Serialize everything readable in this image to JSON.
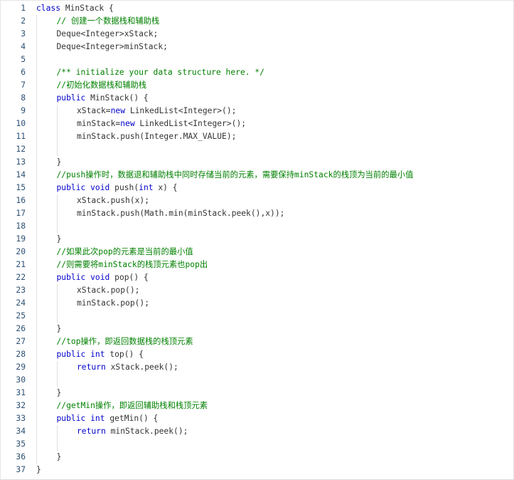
{
  "editor": {
    "colors": {
      "keyword": "#0000cc",
      "comment": "#008000",
      "text": "#333333",
      "line_number": "#2b4f73"
    },
    "lines": [
      {
        "n": "1",
        "indent": 0,
        "tokens": [
          {
            "t": "kw",
            "v": "class"
          },
          {
            "t": "tx",
            "v": " MinStack {"
          }
        ]
      },
      {
        "n": "2",
        "indent": 1,
        "tokens": [
          {
            "t": "cm",
            "v": "// 创建一个数据栈和辅助栈"
          }
        ]
      },
      {
        "n": "3",
        "indent": 1,
        "tokens": [
          {
            "t": "tx",
            "v": "Deque<Integer>xStack;"
          }
        ]
      },
      {
        "n": "4",
        "indent": 1,
        "tokens": [
          {
            "t": "tx",
            "v": "Deque<Integer>minStack;"
          }
        ]
      },
      {
        "n": "5",
        "indent": 1,
        "tokens": []
      },
      {
        "n": "6",
        "indent": 1,
        "tokens": [
          {
            "t": "cm",
            "v": "/** initialize your data structure here. */"
          }
        ]
      },
      {
        "n": "7",
        "indent": 1,
        "tokens": [
          {
            "t": "cm",
            "v": "//初始化数据栈和辅助栈"
          }
        ]
      },
      {
        "n": "8",
        "indent": 1,
        "tokens": [
          {
            "t": "kw",
            "v": "public"
          },
          {
            "t": "tx",
            "v": " MinStack() {"
          }
        ]
      },
      {
        "n": "9",
        "indent": 2,
        "tokens": [
          {
            "t": "tx",
            "v": "xStack="
          },
          {
            "t": "kw",
            "v": "new"
          },
          {
            "t": "tx",
            "v": " LinkedList<Integer>();"
          }
        ]
      },
      {
        "n": "10",
        "indent": 2,
        "tokens": [
          {
            "t": "tx",
            "v": "minStack="
          },
          {
            "t": "kw",
            "v": "new"
          },
          {
            "t": "tx",
            "v": " LinkedList<Integer>();"
          }
        ]
      },
      {
        "n": "11",
        "indent": 2,
        "tokens": [
          {
            "t": "tx",
            "v": "minStack.push(Integer.MAX_VALUE);"
          }
        ]
      },
      {
        "n": "12",
        "indent": 2,
        "tokens": []
      },
      {
        "n": "13",
        "indent": 1,
        "tokens": [
          {
            "t": "tx",
            "v": "}"
          }
        ]
      },
      {
        "n": "14",
        "indent": 1,
        "tokens": [
          {
            "t": "cm",
            "v": "//push操作时，数据退和辅助栈中同时存储当前的元素，需要保持minStack的栈顶为当前的最小值"
          }
        ]
      },
      {
        "n": "15",
        "indent": 1,
        "tokens": [
          {
            "t": "kw",
            "v": "public"
          },
          {
            "t": "tx",
            "v": " "
          },
          {
            "t": "kw",
            "v": "void"
          },
          {
            "t": "tx",
            "v": " push("
          },
          {
            "t": "kw",
            "v": "int"
          },
          {
            "t": "tx",
            "v": " x) {"
          }
        ]
      },
      {
        "n": "16",
        "indent": 2,
        "tokens": [
          {
            "t": "tx",
            "v": "xStack.push(x);"
          }
        ]
      },
      {
        "n": "17",
        "indent": 2,
        "tokens": [
          {
            "t": "tx",
            "v": "minStack.push(Math.min(minStack.peek(),x));"
          }
        ]
      },
      {
        "n": "18",
        "indent": 2,
        "tokens": []
      },
      {
        "n": "19",
        "indent": 1,
        "tokens": [
          {
            "t": "tx",
            "v": "}"
          }
        ]
      },
      {
        "n": "20",
        "indent": 1,
        "tokens": [
          {
            "t": "cm",
            "v": "//如果此次pop的元素是当前的最小值"
          }
        ]
      },
      {
        "n": "21",
        "indent": 1,
        "tokens": [
          {
            "t": "cm",
            "v": "//则需要将minStack的栈顶元素也pop出"
          }
        ]
      },
      {
        "n": "22",
        "indent": 1,
        "tokens": [
          {
            "t": "kw",
            "v": "public"
          },
          {
            "t": "tx",
            "v": " "
          },
          {
            "t": "kw",
            "v": "void"
          },
          {
            "t": "tx",
            "v": " pop() {"
          }
        ]
      },
      {
        "n": "23",
        "indent": 2,
        "tokens": [
          {
            "t": "tx",
            "v": "xStack.pop();"
          }
        ]
      },
      {
        "n": "24",
        "indent": 2,
        "tokens": [
          {
            "t": "tx",
            "v": "minStack.pop();"
          }
        ]
      },
      {
        "n": "25",
        "indent": 2,
        "tokens": []
      },
      {
        "n": "26",
        "indent": 1,
        "tokens": [
          {
            "t": "tx",
            "v": "}"
          }
        ]
      },
      {
        "n": "27",
        "indent": 1,
        "tokens": [
          {
            "t": "cm",
            "v": "//top操作，即返回数据栈的栈顶元素"
          }
        ]
      },
      {
        "n": "28",
        "indent": 1,
        "tokens": [
          {
            "t": "kw",
            "v": "public"
          },
          {
            "t": "tx",
            "v": " "
          },
          {
            "t": "kw",
            "v": "int"
          },
          {
            "t": "tx",
            "v": " top() {"
          }
        ]
      },
      {
        "n": "29",
        "indent": 2,
        "tokens": [
          {
            "t": "kw",
            "v": "return"
          },
          {
            "t": "tx",
            "v": " xStack.peek();"
          }
        ]
      },
      {
        "n": "30",
        "indent": 2,
        "tokens": []
      },
      {
        "n": "31",
        "indent": 1,
        "tokens": [
          {
            "t": "tx",
            "v": "}"
          }
        ]
      },
      {
        "n": "32",
        "indent": 1,
        "tokens": [
          {
            "t": "cm",
            "v": "//getMin操作，即返回辅助栈和栈顶元素"
          }
        ]
      },
      {
        "n": "33",
        "indent": 1,
        "tokens": [
          {
            "t": "kw",
            "v": "public"
          },
          {
            "t": "tx",
            "v": " "
          },
          {
            "t": "kw",
            "v": "int"
          },
          {
            "t": "tx",
            "v": " getMin() {"
          }
        ]
      },
      {
        "n": "34",
        "indent": 2,
        "tokens": [
          {
            "t": "kw",
            "v": "return"
          },
          {
            "t": "tx",
            "v": " minStack.peek();"
          }
        ]
      },
      {
        "n": "35",
        "indent": 2,
        "tokens": []
      },
      {
        "n": "36",
        "indent": 1,
        "tokens": [
          {
            "t": "tx",
            "v": "}"
          }
        ]
      },
      {
        "n": "37",
        "indent": 0,
        "tokens": [
          {
            "t": "tx",
            "v": "}"
          }
        ]
      }
    ]
  }
}
